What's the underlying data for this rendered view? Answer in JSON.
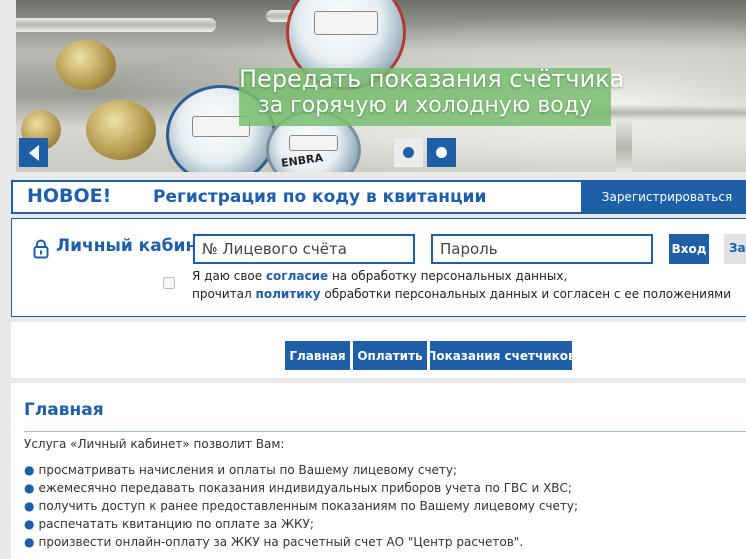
{
  "banner": {
    "caption_line1": "Передать показания счётчика",
    "caption_line2": "за горячую и холодную воду",
    "meter_brand": "ENBRA"
  },
  "notice": {
    "new_label": "НОВОЕ!",
    "registration_text": "Регистрация по коду в квитанции",
    "register_button": "Зарегистрироваться"
  },
  "login": {
    "title": "Личный кабинет",
    "account_placeholder": "№ Лицевого счёта",
    "password_placeholder": "Пароль",
    "login_button": "Вход",
    "forgot_button": "Забыли пароль?",
    "consent_before": "Я даю свое ",
    "consent_link": "согласие",
    "consent_after": " на обработку персональных данных,",
    "policy_before": "прочитал ",
    "policy_link": "политику",
    "policy_after": " обработки персональных данных и согласен с ее положениями"
  },
  "nav": {
    "home": "Главная",
    "pay": "Оплатить",
    "meters": "Показания счетчиков"
  },
  "content": {
    "title": "Главная",
    "intro": "Услуга «Личный кабинет» позволит Вам:",
    "bullet_char": "●",
    "features": [
      "просматривать начисления и оплаты по Вашему лицевому счету;",
      "ежемесячно передавать показания индивидуальных приборов учета по ГВС и ХВС;",
      "получить доступ к ранее предоставленным показаниям по Вашему лицевому счету;",
      "распечатать квитанцию по оплате за ЖКУ;",
      "произвести онлайн-оплату за ЖКУ на расчетный счет АО \"Центр расчетов\"."
    ]
  },
  "colors": {
    "primary": "#1f5fa7",
    "caption_bg": "#78be6e",
    "page_bg": "#e9e9e9"
  }
}
